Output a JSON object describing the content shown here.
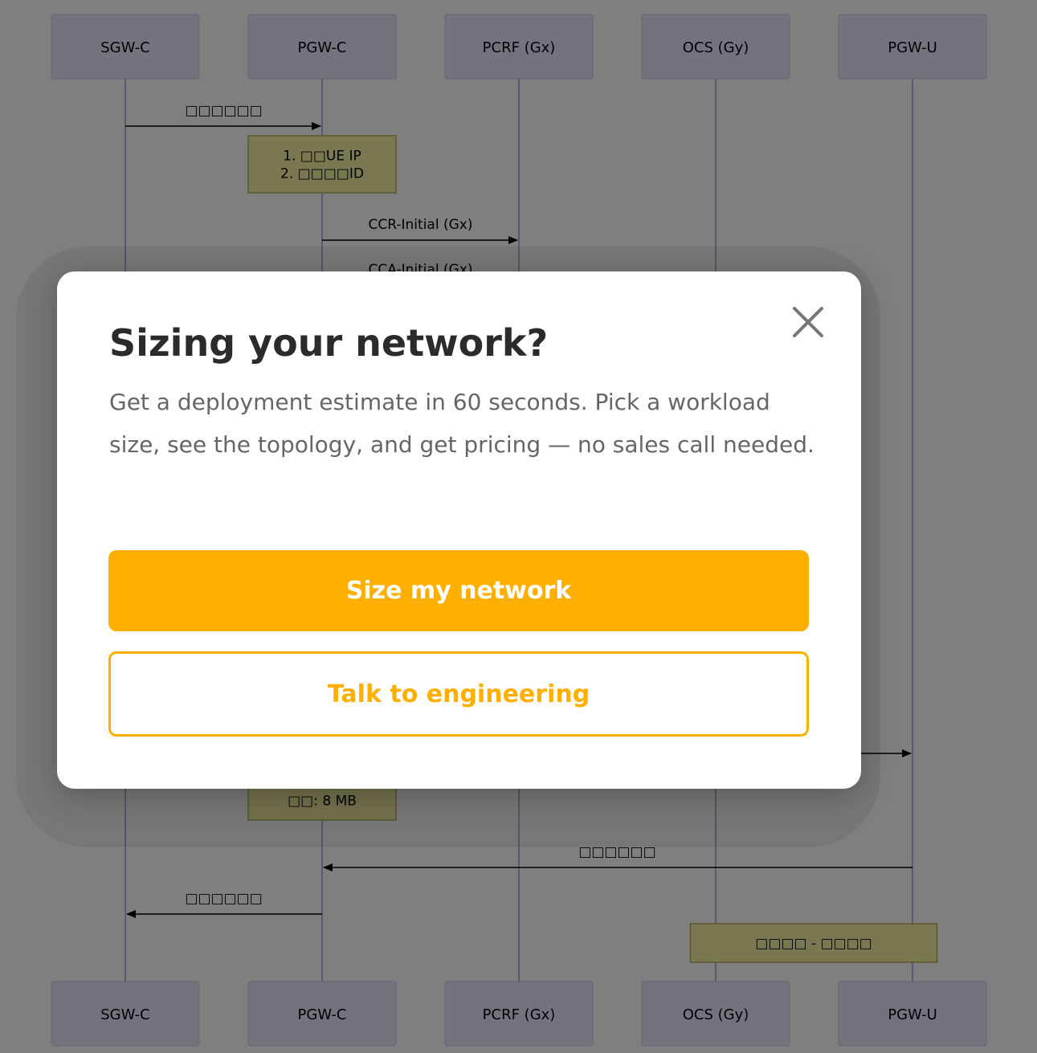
{
  "diagram": {
    "participants": [
      "SGW-C",
      "PGW-C",
      "PCRF (Gx)",
      "OCS (Gy)",
      "PGW-U"
    ],
    "messages": [
      {
        "label": "□□□□□□",
        "from": "SGW-C",
        "to": "PGW-C"
      },
      {
        "label": "CCR-Initial (Gx)",
        "from": "PGW-C",
        "to": "PCRF (Gx)"
      },
      {
        "label": "CCA-Initial (Gx)",
        "from": "PCRF (Gx)",
        "to": "PGW-C"
      },
      {
        "label": "",
        "from": "OCS (Gy)",
        "to": "PGW-U"
      },
      {
        "label": "□□□□□□",
        "from": "PGW-U",
        "to": "PGW-C"
      },
      {
        "label": "□□□□□□",
        "from": "PGW-C",
        "to": "SGW-C"
      }
    ],
    "notes": [
      {
        "over": "PGW-C",
        "lines": [
          "1. □□UE IP",
          "2. □□□□ID"
        ]
      },
      {
        "over": "PGW-C",
        "lines": [
          "□□: 8 MB"
        ]
      },
      {
        "over": "OCS (Gy)",
        "lines": [
          "□□□□ - □□□□"
        ]
      }
    ]
  },
  "modal": {
    "title": "Sizing your network?",
    "body": "Get a deployment estimate in 60 seconds. Pick a workload size, see the topology, and get pricing — no sales call needed.",
    "primary_label": "Size my network",
    "secondary_label": "Talk to engineering",
    "close_symbol": "×"
  },
  "colors": {
    "accent": "#ffaf00",
    "participant_fill": "#e6e6fa",
    "note_fill": "#f5f0a0",
    "overlay": "rgba(0,0,0,0.5)"
  },
  "icons": {
    "close": "close-icon"
  }
}
